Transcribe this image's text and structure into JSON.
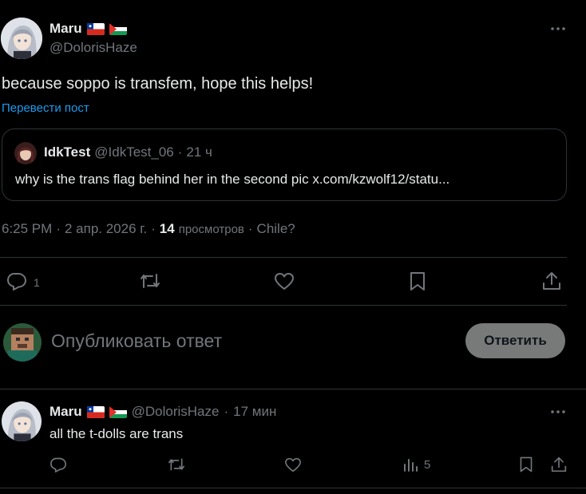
{
  "colors": {
    "background": "#000000",
    "text": "#e7e9ea",
    "muted": "#71767b",
    "link": "#1d9bf0",
    "border": "#2f3336",
    "button_bg": "#787a7a"
  },
  "post": {
    "author_name": "Maru",
    "author_handle": "@DolorisHaze",
    "flags": [
      "chile-flag-icon",
      "palestine-flag-icon"
    ],
    "text": "because soppo is transfem, hope this helps!",
    "translate_link": "Перевести пост",
    "more_icon": "more-icon",
    "quote": {
      "author_name": "IdkTest",
      "author_handle": "@IdkTest_06",
      "separator": "·",
      "time": "21 ч",
      "text": "why is the trans flag behind her in the second pic x.com/kzwolf12/statu..."
    },
    "meta": {
      "time": "6:25 PM",
      "sep1": "·",
      "date": "2 апр. 2026 г.",
      "sep2": "·",
      "views_count": "14",
      "views_label": "просмотров",
      "sep3": "·",
      "location": "Chile?"
    },
    "actions": {
      "reply_count": "1"
    }
  },
  "composer": {
    "placeholder": "Опубликовать ответ",
    "button_label": "Ответить"
  },
  "reply": {
    "author_name": "Maru",
    "author_handle": "@DolorisHaze",
    "separator": "·",
    "time": "17 мин",
    "text": "all the t-dolls are trans",
    "views_count": "5"
  }
}
